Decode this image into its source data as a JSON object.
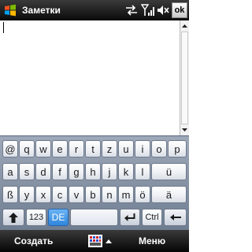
{
  "titlebar": {
    "title": "Заметки",
    "ok_label": "ok",
    "icons": [
      "windows-start-icon",
      "data-sync-icon",
      "signal-icon",
      "volume-mute-icon"
    ]
  },
  "note": {
    "text": ""
  },
  "keyboard": {
    "rows": [
      [
        "@",
        "q",
        "w",
        "e",
        "r",
        "t",
        "z",
        "u",
        "i",
        "o",
        "p"
      ],
      [
        "a",
        "s",
        "d",
        "f",
        "g",
        "h",
        "j",
        "k",
        "l",
        "ü"
      ],
      [
        "ß",
        "y",
        "x",
        "c",
        "v",
        "b",
        "n",
        "m",
        "ö",
        "ä"
      ]
    ],
    "num_label": "123",
    "lang_label": "DE",
    "ctrl_label": "Ctrl",
    "icons": [
      "shift-icon",
      "enter-icon",
      "backspace-icon"
    ]
  },
  "softkeys": {
    "left": "Создать",
    "right": "Меню"
  },
  "colors": {
    "titlebar": "#1a1a1a",
    "keyboard_bg": "#8996a8",
    "lang_key": "#3d92e4"
  }
}
